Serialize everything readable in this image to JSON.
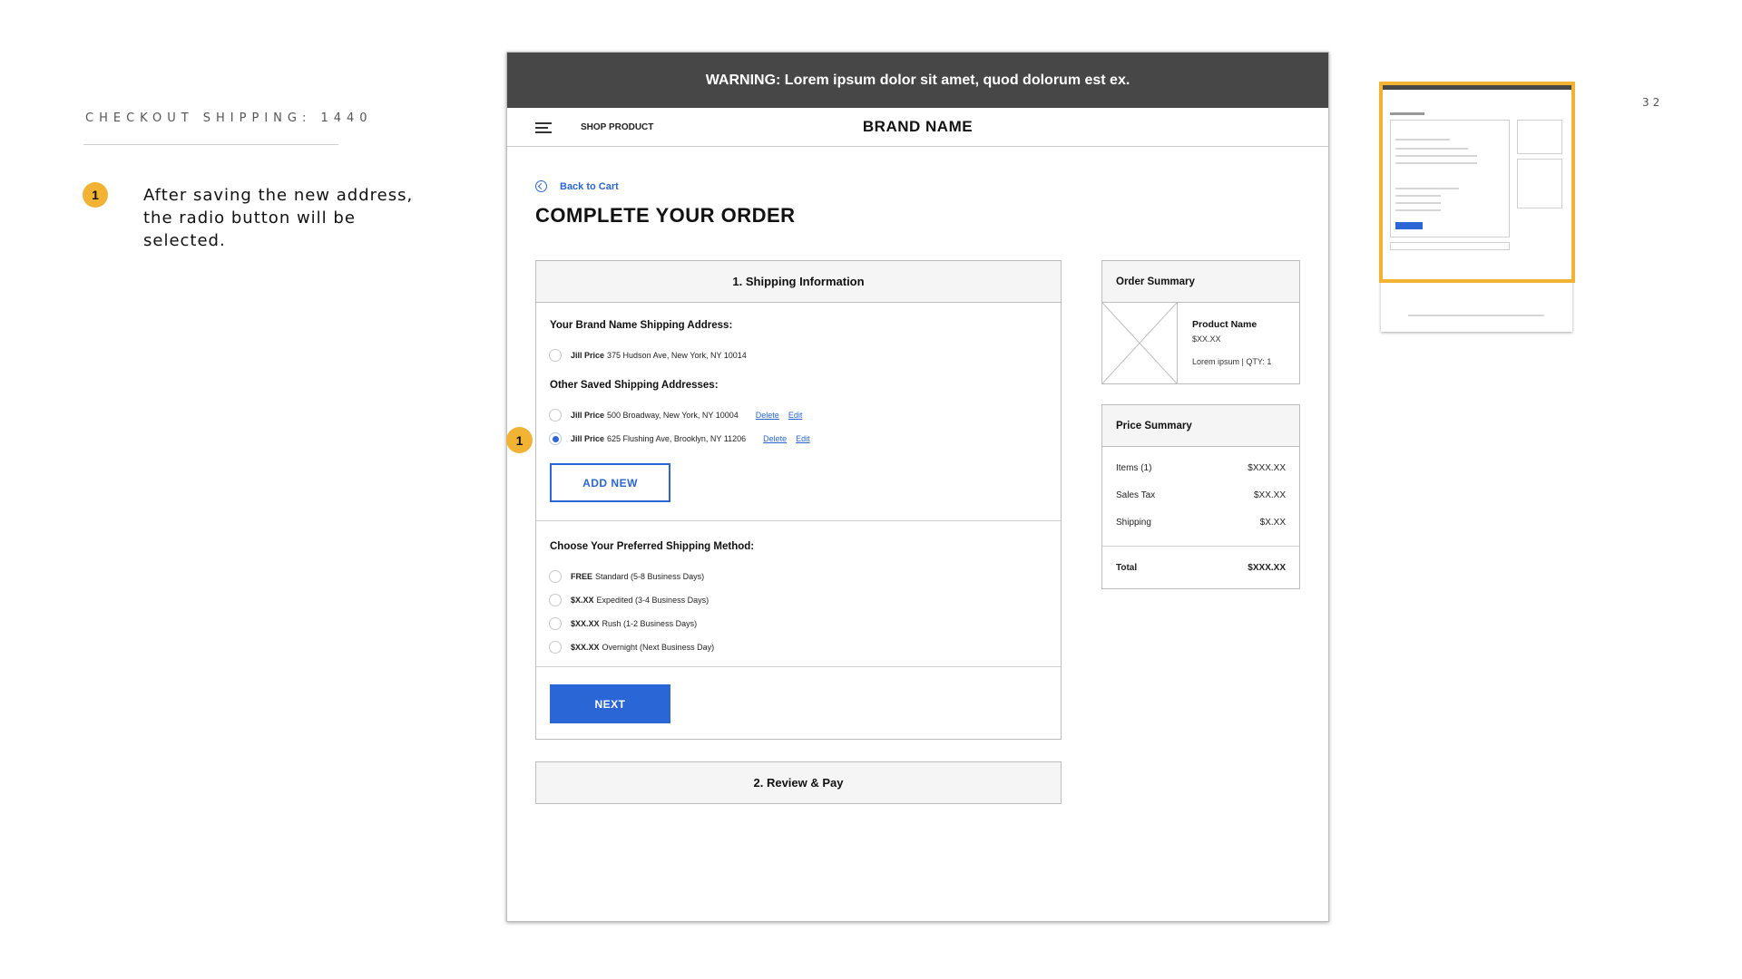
{
  "annotation": {
    "title": "CHECKOUT SHIPPING: 1440",
    "badge": "1",
    "text": "After saving the new address, the radio button will be selected."
  },
  "page_number": "32",
  "mockup": {
    "warning": "WARNING: Lorem ipsum dolor sit amet, quod dolorum est ex.",
    "nav": {
      "shop_link": "SHOP PRODUCT",
      "brand": "BRAND NAME"
    },
    "back_link": "Back to Cart",
    "page_title": "COMPLETE YOUR ORDER",
    "shipping": {
      "header": "1. Shipping Information",
      "brand_address_label": "Your Brand Name Shipping Address:",
      "brand_address": {
        "name": "Jill Price",
        "address": "375 Hudson Ave, New York, NY 10014",
        "selected": false
      },
      "other_label": "Other Saved Shipping Addresses:",
      "other_addresses": [
        {
          "name": "Jill Price",
          "address": "500 Broadway, New York, NY 10004",
          "delete": "Delete",
          "edit": "Edit",
          "selected": false
        },
        {
          "name": "Jill Price",
          "address": "625 Flushing Ave, Brooklyn, NY 11206",
          "delete": "Delete",
          "edit": "Edit",
          "selected": true
        }
      ],
      "add_new": "ADD NEW",
      "method_label": "Choose Your Preferred Shipping Method:",
      "methods": [
        {
          "price": "FREE",
          "desc": "Standard (5-8 Business Days)"
        },
        {
          "price": "$X.XX",
          "desc": "Expedited (3-4 Business Days)"
        },
        {
          "price": "$XX.XX",
          "desc": "Rush (1-2 Business Days)"
        },
        {
          "price": "$XX.XX",
          "desc": "Overnight (Next Business Day)"
        }
      ],
      "next": "NEXT"
    },
    "review_header": "2. Review & Pay",
    "order_summary": {
      "header": "Order Summary",
      "product_name": "Product Name",
      "product_price": "$XX.XX",
      "product_meta": "Lorem ipsum | QTY: 1"
    },
    "price_summary": {
      "header": "Price Summary",
      "rows": [
        {
          "label": "Items (1)",
          "value": "$XXX.XX"
        },
        {
          "label": "Sales Tax",
          "value": "$XX.XX"
        },
        {
          "label": "Shipping",
          "value": "$X.XX"
        }
      ],
      "total_label": "Total",
      "total_value": "$XXX.XX"
    },
    "marker": "1"
  },
  "colors": {
    "accent": "#2a66d6",
    "marker": "#f2b233",
    "warning_bar": "#474747"
  }
}
